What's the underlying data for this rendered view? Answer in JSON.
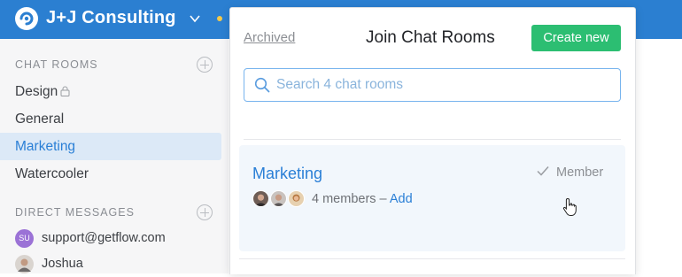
{
  "app": {
    "team_name": "J+J Consulting",
    "colors": {
      "topbar": "#2b7fd1",
      "accent": "#2a7fd6",
      "create": "#2cbe72",
      "status_dot": "#f3c94a"
    }
  },
  "sidebar": {
    "chat_rooms_title": "CHAT ROOMS",
    "rooms": [
      {
        "label": "Design",
        "locked": true
      },
      {
        "label": "General"
      },
      {
        "label": "Marketing",
        "active": true
      },
      {
        "label": "Watercooler"
      }
    ],
    "direct_messages_title": "DIRECT MESSAGES",
    "dms": [
      {
        "label": "support@getflow.com",
        "avatar_initials": "SU"
      },
      {
        "label": "Joshua"
      }
    ]
  },
  "popover": {
    "archived_label": "Archived",
    "title": "Join Chat Rooms",
    "create_label": "Create new",
    "search_placeholder": "Search 4 chat rooms",
    "room": {
      "name": "Marketing",
      "member_status": "Member",
      "members_text": "4 members –",
      "add_label": "Add"
    }
  },
  "icons": [
    "flow-logo-icon",
    "chevron-down-icon",
    "lock-icon",
    "add-circle-icon",
    "search-icon",
    "checkmark-icon",
    "hand-cursor-icon"
  ]
}
